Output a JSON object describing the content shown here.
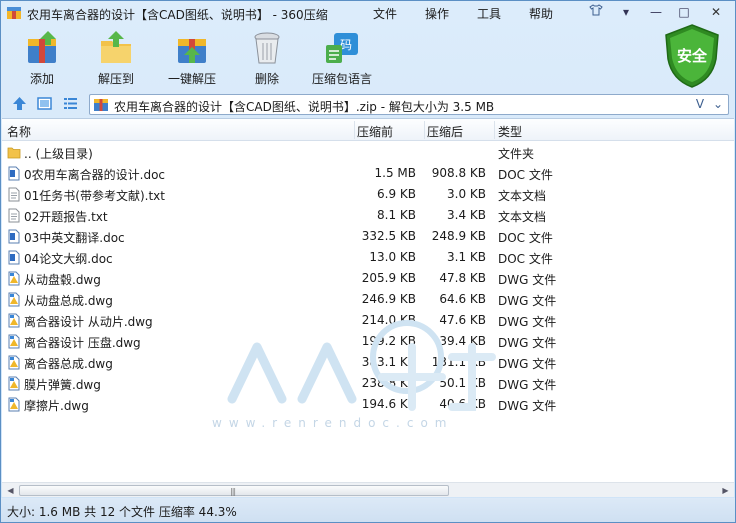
{
  "window": {
    "title": "农用车离合器的设计【含CAD图纸、说明书】 - 360压缩",
    "menu": [
      "文件",
      "操作",
      "工具",
      "帮助"
    ]
  },
  "toolbar": {
    "buttons": [
      {
        "label": "添加",
        "icon": "add-archive-icon"
      },
      {
        "label": "解压到",
        "icon": "extract-to-icon"
      },
      {
        "label": "一键解压",
        "icon": "one-click-extract-icon"
      },
      {
        "label": "删除",
        "icon": "trash-icon"
      },
      {
        "label": "压缩包语言",
        "icon": "archive-language-icon"
      }
    ],
    "safe_badge": "安全",
    "safe_color": "#3f9a2f"
  },
  "address_bar": {
    "path": "农用车离合器的设计【含CAD图纸、说明书】.zip - 解包大小为 3.5 MB"
  },
  "columns": {
    "name": "名称",
    "size": "压缩前",
    "packed": "压缩后",
    "type": "类型"
  },
  "files": [
    {
      "name": ".. (上级目录)",
      "size": "",
      "packed": "",
      "type": "文件夹",
      "icon": "folder-icon"
    },
    {
      "name": "0农用车离合器的设计.doc",
      "size": "1.5 MB",
      "packed": "908.8 KB",
      "type": "DOC 文件",
      "icon": "doc-file-icon"
    },
    {
      "name": "01任务书(带参考文献).txt",
      "size": "6.9 KB",
      "packed": "3.0 KB",
      "type": "文本文档",
      "icon": "txt-file-icon"
    },
    {
      "name": "02开题报告.txt",
      "size": "8.1 KB",
      "packed": "3.4 KB",
      "type": "文本文档",
      "icon": "txt-file-icon"
    },
    {
      "name": "03中英文翻译.doc",
      "size": "332.5 KB",
      "packed": "248.9 KB",
      "type": "DOC 文件",
      "icon": "doc-file-icon"
    },
    {
      "name": "04论文大纲.doc",
      "size": "13.0 KB",
      "packed": "3.1 KB",
      "type": "DOC 文件",
      "icon": "doc-file-icon"
    },
    {
      "name": "从动盘毂.dwg",
      "size": "205.9 KB",
      "packed": "47.8 KB",
      "type": "DWG 文件",
      "icon": "dwg-file-icon"
    },
    {
      "name": "从动盘总成.dwg",
      "size": "246.9 KB",
      "packed": "64.6 KB",
      "type": "DWG 文件",
      "icon": "dwg-file-icon"
    },
    {
      "name": "离合器设计 从动片.dwg",
      "size": "214.0 KB",
      "packed": "47.6 KB",
      "type": "DWG 文件",
      "icon": "dwg-file-icon"
    },
    {
      "name": "离合器设计 压盘.dwg",
      "size": "199.2 KB",
      "packed": "39.4 KB",
      "type": "DWG 文件",
      "icon": "dwg-file-icon"
    },
    {
      "name": "离合器总成.dwg",
      "size": "383.1 KB",
      "packed": "131.1 KB",
      "type": "DWG 文件",
      "icon": "dwg-file-icon"
    },
    {
      "name": "膜片弹簧.dwg",
      "size": "238.8 KB",
      "packed": "50.1 KB",
      "type": "DWG 文件",
      "icon": "dwg-file-icon"
    },
    {
      "name": "摩擦片.dwg",
      "size": "194.6 KB",
      "packed": "40.6 KB",
      "type": "DWG 文件",
      "icon": "dwg-file-icon"
    }
  ],
  "status": {
    "text": "大小: 1.6 MB 共 12 个文件 压缩率 44.3%"
  },
  "colors": {
    "frame": "#cfe3f7",
    "accent": "#2f6fb5"
  }
}
